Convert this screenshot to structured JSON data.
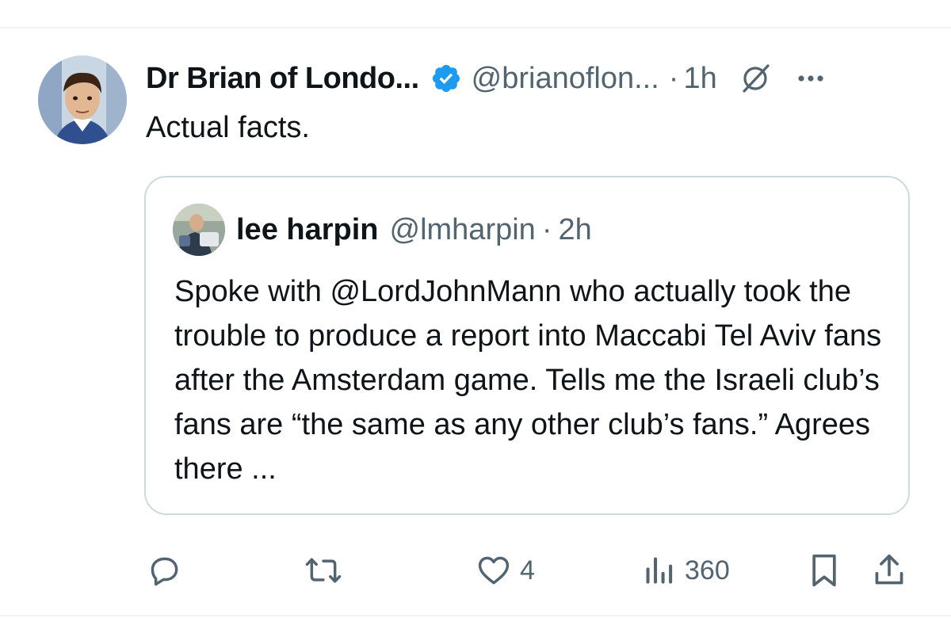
{
  "tweet": {
    "author_name": "Dr Brian of Londo...",
    "author_handle": "@brianoflon...",
    "separator": "·",
    "time": "1h",
    "text": "Actual facts.",
    "avatar_icon": "person-avatar",
    "verified_icon": "verified-badge-icon",
    "verified_color": "#1d9bf0"
  },
  "quoted_tweet": {
    "author_name": "lee harpin",
    "author_handle": "@lmharpin",
    "separator": "·",
    "time": "2h",
    "text": "Spoke with @LordJohnMann who actually took the trouble to produce a report into Maccabi Tel Aviv fans after the Amsterdam game. Tells me the Israeli club’s fans are “the same as any other club’s fans.” Agrees there ..."
  },
  "actions": {
    "reply_count": "",
    "repost_count": "",
    "like_count": "4",
    "view_count": "360"
  },
  "colors": {
    "text_primary": "#0f1419",
    "text_secondary": "#536471",
    "border": "#cfd9de",
    "accent": "#1d9bf0"
  }
}
